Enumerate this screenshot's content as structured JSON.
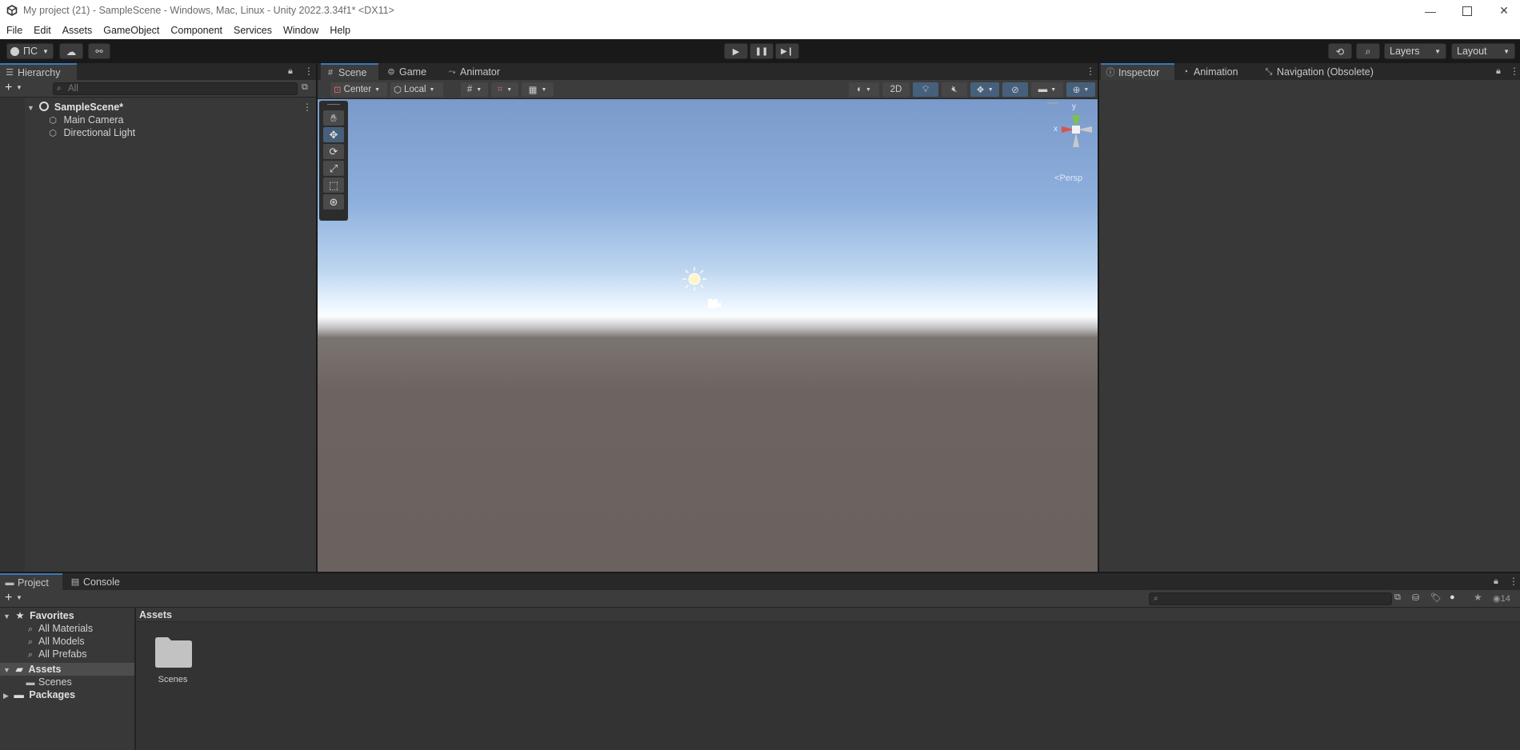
{
  "window": {
    "title": "My project (21) - SampleScene - Windows, Mac, Linux - Unity 2022.3.34f1* <DX11>"
  },
  "menu": [
    "File",
    "Edit",
    "Assets",
    "GameObject",
    "Component",
    "Services",
    "Window",
    "Help"
  ],
  "toolbar": {
    "account_label": "ПС",
    "layers_label": "Layers",
    "layout_label": "Layout"
  },
  "hierarchy": {
    "tab": "Hierarchy",
    "search_placeholder": "All",
    "scene": "SampleScene*",
    "items": [
      "Main Camera",
      "Directional Light"
    ]
  },
  "scene_view": {
    "tabs": [
      "Scene",
      "Game",
      "Animator"
    ],
    "pivot_label": "Center",
    "space_label": "Local",
    "mode_2d_label": "2D",
    "persp_label": "Persp",
    "gizmo_x": "x",
    "gizmo_y": "y"
  },
  "inspector": {
    "tabs": [
      "Inspector",
      "Animation",
      "Navigation (Obsolete)"
    ]
  },
  "bottom": {
    "tabs": [
      "Project",
      "Console"
    ],
    "hidden_count": "14",
    "favorites": {
      "label": "Favorites",
      "items": [
        "All Materials",
        "All Models",
        "All Prefabs"
      ]
    },
    "assets_label": "Assets",
    "assets_children": [
      "Scenes"
    ],
    "packages_label": "Packages",
    "breadcrumb": "Assets",
    "grid_items": [
      "Scenes"
    ]
  },
  "colors": {
    "accent": "#3a79bb",
    "panel": "#383838",
    "dark": "#191919",
    "sky_top": "#7a9acb",
    "ground": "#6a625e"
  }
}
